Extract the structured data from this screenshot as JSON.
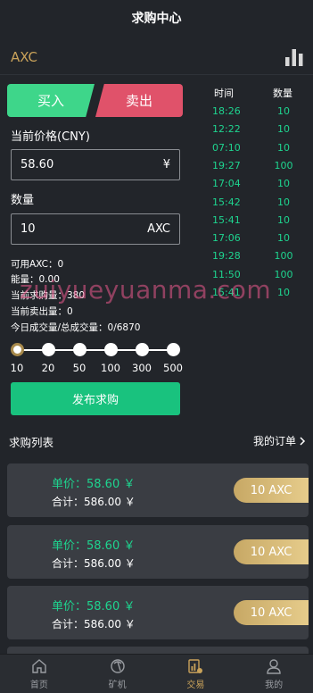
{
  "header": {
    "title": "求购中心"
  },
  "coin": {
    "name": "AXC"
  },
  "tabs": {
    "buy": "买入",
    "sell": "卖出"
  },
  "form": {
    "price_label": "当前价格(CNY)",
    "price_value": "58.60",
    "price_unit": "¥",
    "qty_label": "数量",
    "qty_value": "10",
    "qty_unit": "AXC"
  },
  "info": {
    "available": "可用AXC：0",
    "energy": "能量：0.00",
    "buy_count": "当前求购量：380",
    "sell_count": "当前卖出量：0",
    "daily": "今日成交量/总成交量：0/6870"
  },
  "slider": {
    "options": [
      "10",
      "20",
      "50",
      "100",
      "300",
      "500"
    ],
    "selected_index": 0
  },
  "publish_button": "发布求购",
  "trades": {
    "time_header": "时间",
    "qty_header": "数量",
    "rows": [
      {
        "time": "18:26",
        "qty": "10"
      },
      {
        "time": "12:22",
        "qty": "10"
      },
      {
        "time": "07:10",
        "qty": "10"
      },
      {
        "time": "19:27",
        "qty": "100"
      },
      {
        "time": "17:04",
        "qty": "10"
      },
      {
        "time": "15:42",
        "qty": "10"
      },
      {
        "time": "15:41",
        "qty": "10"
      },
      {
        "time": "17:06",
        "qty": "10"
      },
      {
        "time": "19:28",
        "qty": "100"
      },
      {
        "time": "11:50",
        "qty": "100"
      },
      {
        "time": "15:41",
        "qty": "10"
      }
    ]
  },
  "list": {
    "title": "求购列表",
    "my_orders": "我的订单",
    "items": [
      {
        "price": "单价：58.60 ￥",
        "total": "合计：586.00 ￥",
        "amount": "10 AXC"
      },
      {
        "price": "单价：58.60 ￥",
        "total": "合计：586.00 ￥",
        "amount": "10 AXC"
      },
      {
        "price": "单价：58.60 ￥",
        "total": "合计：586.00 ￥",
        "amount": "10 AXC"
      }
    ]
  },
  "nav": {
    "home": "首页",
    "miner": "矿机",
    "trade": "交易",
    "mine": "我的"
  },
  "watermark": "zuiyueyuanma.com",
  "colors": {
    "buy": "#3ed68a",
    "sell": "#e0526a",
    "accent": "#c9a25a",
    "green_text": "#1ed48f"
  }
}
